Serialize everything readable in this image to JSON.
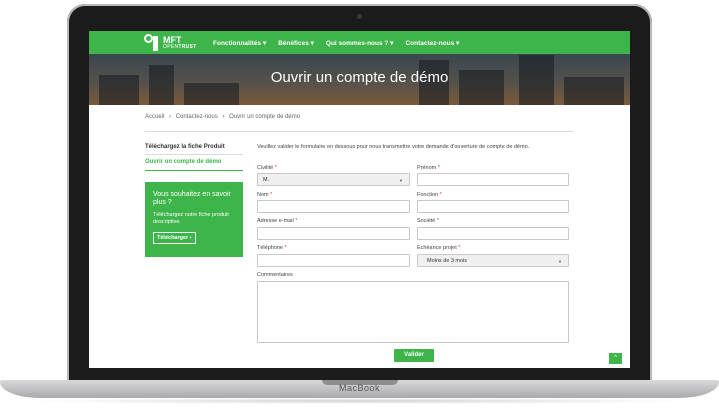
{
  "device": {
    "brand": "MacBook"
  },
  "logo": {
    "line1": "MFT",
    "line2a": "OPEN",
    "line2b": "TRUST"
  },
  "nav": {
    "items": [
      {
        "label": "Fonctionnalités ▾"
      },
      {
        "label": "Bénéfices ▾"
      },
      {
        "label": "Qui sommes-nous ? ▾"
      },
      {
        "label": "Contactez-nous ▾"
      }
    ]
  },
  "hero": {
    "title": "Ouvrir un compte de démo"
  },
  "breadcrumb": {
    "items": [
      "Accueil",
      "›",
      "Contactez-nous",
      "›",
      "Ouvrir un compte de démo"
    ]
  },
  "sidebar": {
    "items": [
      {
        "label": "Téléchargez la fiche Produit"
      },
      {
        "label": "Ouvrir un compte de démo"
      }
    ]
  },
  "promo": {
    "title": "Vous souhaitez en savoir plus ?",
    "text": "Téléchargez notre fiche produit descriptive.",
    "button": "Télécharger ›"
  },
  "form": {
    "intro": "Veuillez valider le formulaire en dessous pour nous transmettre votre demande d'ouverture de compte de démo.",
    "civilite": {
      "label": "Civilité",
      "value": "M."
    },
    "prenom": {
      "label": "Prénom"
    },
    "nom": {
      "label": "Nom"
    },
    "fonction": {
      "label": "Fonction"
    },
    "email": {
      "label": "Adresse e-mail"
    },
    "societe": {
      "label": "Société"
    },
    "telephone": {
      "label": "Téléphone"
    },
    "echeance": {
      "label": "Echéance projet",
      "value": "Moins de 3 mois"
    },
    "commentaires": {
      "label": "Commentaires"
    },
    "required_mark": "*",
    "submit": "Valider"
  },
  "back_to_top": "^"
}
